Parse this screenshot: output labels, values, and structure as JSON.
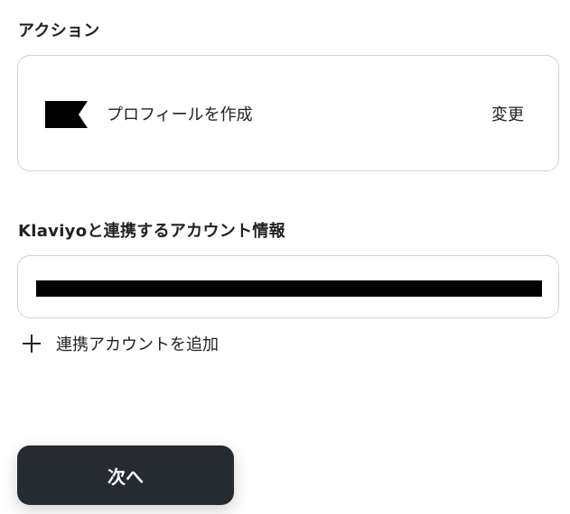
{
  "action_section": {
    "label": "アクション",
    "card": {
      "logo_icon": "klaviyo-flag-icon",
      "action_name": "プロフィールを作成",
      "change_label": "変更"
    }
  },
  "account_section": {
    "label": "Klaviyoと連携するアカウント情報",
    "add_account_label": "連携アカウントを追加",
    "add_icon": "plus-icon"
  },
  "footer": {
    "next_label": "次へ"
  },
  "colors": {
    "button_bg": "#262a31",
    "border": "#cfd3d8",
    "text": "#222222"
  }
}
